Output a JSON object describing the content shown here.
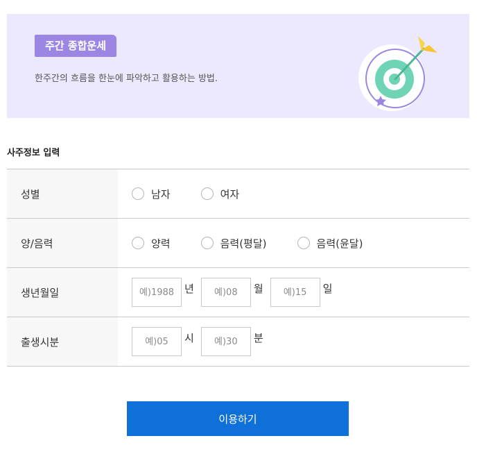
{
  "banner": {
    "badge": "주간 종합운세",
    "subtitle": "한주간의 흐름을 한눈에 파악하고 활용하는 방법."
  },
  "section_title": "사주정보 입력",
  "form": {
    "gender": {
      "label": "성별",
      "options": [
        "남자",
        "여자"
      ]
    },
    "calendar": {
      "label": "양/음력",
      "options": [
        "양력",
        "음력(평달)",
        "음력(윤달)"
      ]
    },
    "birthdate": {
      "label": "생년월일",
      "year_placeholder": "예)1988",
      "year_unit": "년",
      "month_placeholder": "예)08",
      "month_unit": "월",
      "day_placeholder": "예)15",
      "day_unit": "일"
    },
    "birthtime": {
      "label": "출생시분",
      "hour_placeholder": "예)05",
      "hour_unit": "시",
      "minute_placeholder": "예)30",
      "minute_unit": "분"
    }
  },
  "submit_label": "이용하기",
  "colors": {
    "banner_bg": "#ece8fd",
    "badge_bg": "#9b86e4",
    "button_bg": "#0f70d9",
    "target_green": "#6fd3b5",
    "arrow_yellow": "#f7d64a"
  }
}
